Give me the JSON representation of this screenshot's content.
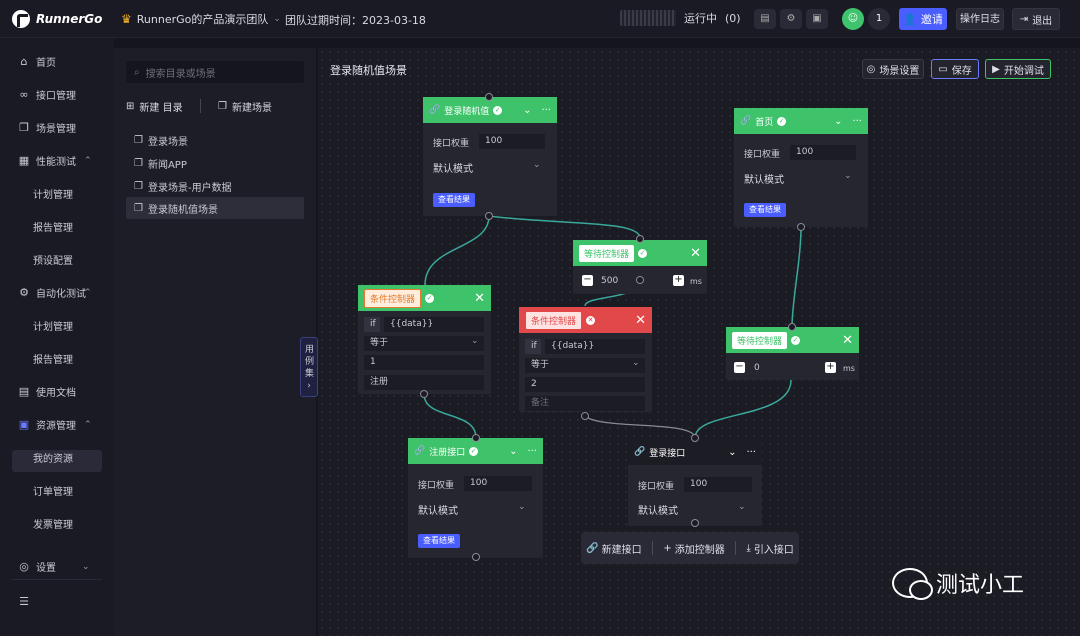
{
  "header": {
    "logo": "RunnerGo",
    "team": "RunnerGo的产品演示团队",
    "expire": "团队过期时间：2023-03-18",
    "running_label": "运行中",
    "running_count": "(0)",
    "avatar_text": "",
    "member_count": "1",
    "invite": "邀请",
    "oplog": "操作日志",
    "logout": "退出"
  },
  "sidebar": {
    "items": [
      {
        "label": "首页",
        "icon": "home-icon"
      },
      {
        "label": "接口管理",
        "icon": "link-icon"
      },
      {
        "label": "场景管理",
        "icon": "scene-icon"
      },
      {
        "label": "性能测试",
        "icon": "chart-icon"
      },
      {
        "label": "计划管理"
      },
      {
        "label": "报告管理"
      },
      {
        "label": "预设配置"
      },
      {
        "label": "自动化测试",
        "icon": "robot-icon"
      },
      {
        "label": "计划管理"
      },
      {
        "label": "报告管理"
      },
      {
        "label": "使用文档",
        "icon": "doc-icon"
      },
      {
        "label": "资源管理",
        "icon": "resource-icon"
      },
      {
        "label": "我的资源"
      },
      {
        "label": "订单管理"
      },
      {
        "label": "发票管理"
      },
      {
        "label": "设置",
        "icon": "gear-icon"
      }
    ]
  },
  "tree": {
    "search_placeholder": "搜索目录或场景",
    "new_dir": "新建 目录",
    "new_scene": "新建场景",
    "items": [
      "登录场景",
      "新闻APP",
      "登录场景-用户数据",
      "登录随机值场景"
    ],
    "usecase": "用例集"
  },
  "canvas": {
    "title": "登录随机值场景",
    "scene_settings": "场景设置",
    "save": "保存",
    "debug": "开始调试",
    "nodes": {
      "login_random": {
        "name": "登录随机值",
        "weight_label": "接口权重",
        "weight": "100",
        "mode": "默认模式",
        "result": "查看结果"
      },
      "home": {
        "name": "首页",
        "weight_label": "接口权重",
        "weight": "100",
        "mode": "默认模式",
        "result": "查看结果"
      },
      "wait1": {
        "name": "等待控制器",
        "value": "500",
        "unit": "ms"
      },
      "cond1": {
        "name": "条件控制器",
        "if": "if",
        "var": "{{data}}",
        "op": "等于",
        "value": "1",
        "note": "注册"
      },
      "cond2": {
        "name": "条件控制器",
        "if": "if",
        "var": "{{data}}",
        "op": "等于",
        "value": "2",
        "note": "备注"
      },
      "wait2": {
        "name": "等待控制器",
        "value": "0",
        "unit": "ms"
      },
      "register": {
        "name": "注册接口",
        "weight_label": "接口权重",
        "weight": "100",
        "mode": "默认模式",
        "result": "查看结果"
      },
      "login": {
        "name": "登录接口",
        "weight_label": "接口权重",
        "weight": "100",
        "mode": "默认模式"
      }
    },
    "bottom": {
      "new_api": "新建接口",
      "add_ctrl": "添加控制器",
      "import_api": "引入接口"
    }
  },
  "watermark": "测试小工"
}
